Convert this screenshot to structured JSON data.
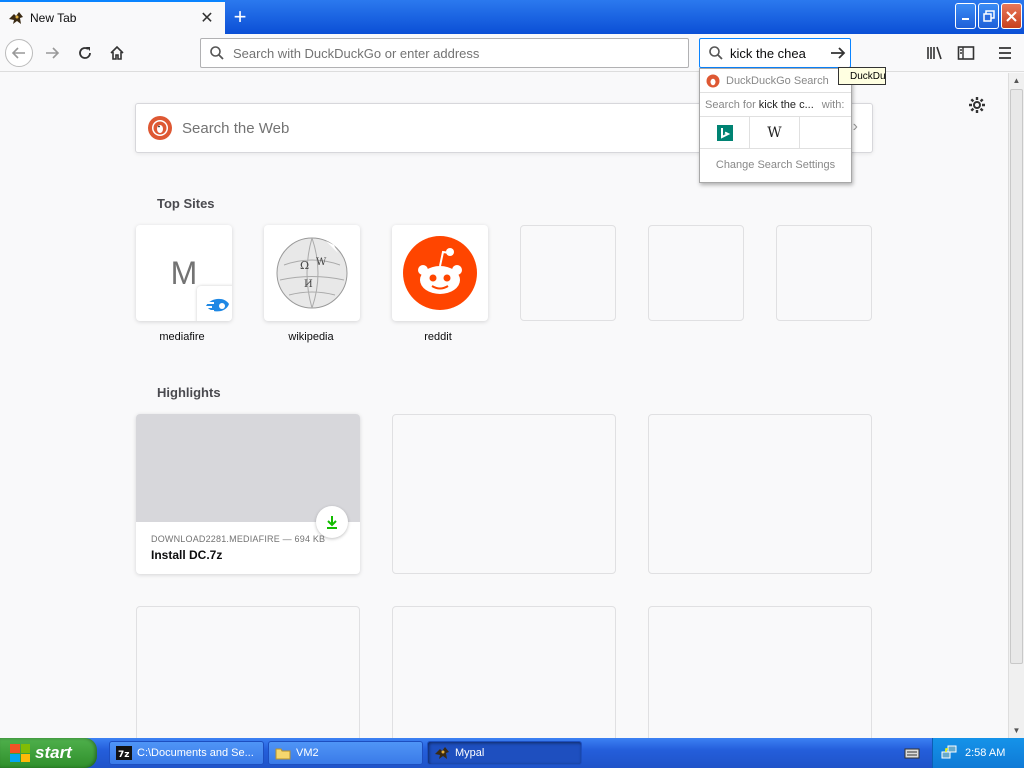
{
  "browser": {
    "tab_title": "New Tab",
    "url_placeholder": "Search with DuckDuckGo or enter address",
    "search_value": "kick the chea"
  },
  "content": {
    "websearch_placeholder": "Search the Web",
    "top_sites_title": "Top Sites",
    "top_sites": [
      {
        "label": "mediafire",
        "letter": "M"
      },
      {
        "label": "wikipedia"
      },
      {
        "label": "reddit"
      }
    ],
    "highlights_title": "Highlights",
    "highlight": {
      "meta": "DOWNLOAD2281.MEDIAFIRE — 694 KB",
      "title": "Install DC.7z"
    }
  },
  "search_popup": {
    "header": "DuckDuckGo Search",
    "search_for_label": "Search for",
    "search_for_query": "kick the c...",
    "with_label": "with:",
    "engines": [
      "bing",
      "wikipedia"
    ],
    "settings_label": "Change Search Settings",
    "tooltip": "DuckDuckGo"
  },
  "taskbar": {
    "start_label": "start",
    "tasks": [
      {
        "label": "C:\\Documents and Se...",
        "icon": "7zip-icon"
      },
      {
        "label": "VM2",
        "icon": "folder-icon"
      },
      {
        "label": "Mypal",
        "icon": "mypal-icon"
      }
    ],
    "clock": "2:58 AM"
  },
  "colors": {
    "accent": "#0a84ff",
    "ddg": "#de5833",
    "reddit": "#ff4500",
    "xp_taskbar": "#245edb",
    "xp_start": "#3c9a37"
  }
}
